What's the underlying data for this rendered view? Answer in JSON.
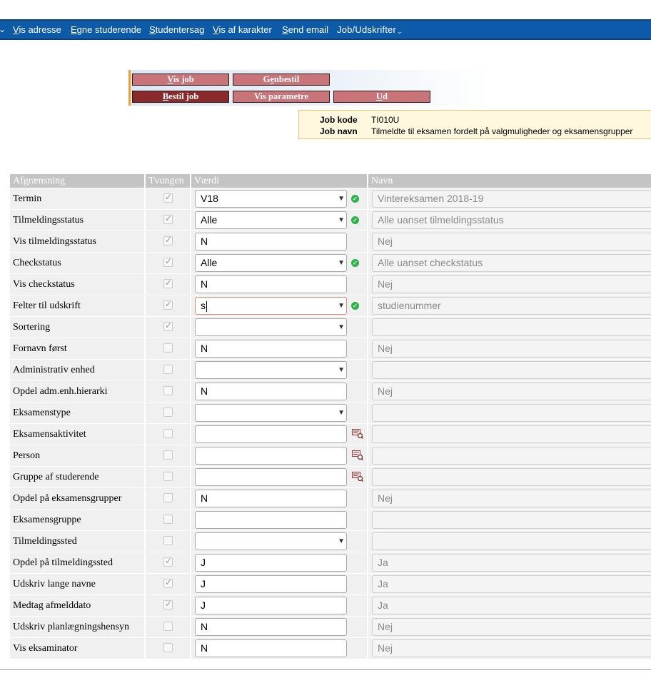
{
  "nav": {
    "items": [
      {
        "accel": "V",
        "rest": "is adresse"
      },
      {
        "accel": "E",
        "rest": "gne studerende"
      },
      {
        "accel": "S",
        "rest": "tudentersag"
      },
      {
        "accel": "V",
        "rest": "is af karakter"
      },
      {
        "accel": "S",
        "rest": "end email"
      }
    ],
    "job_menu": "Job/Udskrifter"
  },
  "buttons": {
    "vis_job": {
      "accel": "V",
      "rest": "is job"
    },
    "genbestil": {
      "pre": "G",
      "accel": "e",
      "rest": "nbestil"
    },
    "bestil_job": {
      "accel": "B",
      "rest": "estil job"
    },
    "vis_parametre": "Vis parametre",
    "ud": {
      "accel": "U",
      "rest": "d"
    }
  },
  "job_info": {
    "kode_label": "Job kode",
    "kode_value": "TI010U",
    "navn_label": "Job navn",
    "navn_value": "Tilmeldte til eksamen fordelt på valgmuligheder og eksamensgrupper"
  },
  "table": {
    "headers": {
      "afgraensning": "Afgrænsning",
      "tvungen": "Tvungen",
      "vaerdi": "Værdi",
      "navn": "Navn"
    },
    "rows": [
      {
        "label": "Termin",
        "forced": true,
        "value": "V18",
        "kind": "select",
        "status": "ok",
        "navn": "Vintereksamen 2018-19"
      },
      {
        "label": "Tilmeldingsstatus",
        "forced": true,
        "value": "Alle",
        "kind": "select",
        "status": "ok",
        "navn": "Alle uanset tilmeldingsstatus"
      },
      {
        "label": "Vis tilmeldingsstatus",
        "forced": true,
        "value": "N",
        "kind": "text",
        "status": "",
        "navn": "Nej"
      },
      {
        "label": "Checkstatus",
        "forced": true,
        "value": "Alle",
        "kind": "select",
        "status": "ok",
        "navn": "Alle uanset checkstatus"
      },
      {
        "label": "Vis checkstatus",
        "forced": true,
        "value": "N",
        "kind": "text",
        "status": "",
        "navn": "Nej"
      },
      {
        "label": "Felter til udskrift",
        "forced": true,
        "value": "s",
        "kind": "select-focused",
        "status": "ok",
        "navn": "studienummer"
      },
      {
        "label": "Sortering",
        "forced": true,
        "value": "",
        "kind": "select",
        "status": "",
        "navn": ""
      },
      {
        "label": "Fornavn først",
        "forced": false,
        "value": "N",
        "kind": "text",
        "status": "",
        "navn": "Nej"
      },
      {
        "label": "Administrativ enhed",
        "forced": false,
        "value": "",
        "kind": "select",
        "status": "",
        "navn": ""
      },
      {
        "label": "Opdel adm.enh.hierarki",
        "forced": false,
        "value": "N",
        "kind": "text",
        "status": "",
        "navn": "Nej"
      },
      {
        "label": "Eksamenstype",
        "forced": false,
        "value": "",
        "kind": "select",
        "status": "",
        "navn": ""
      },
      {
        "label": "Eksamensaktivitet",
        "forced": false,
        "value": "",
        "kind": "text",
        "status": "lookup",
        "navn": ""
      },
      {
        "label": "Person",
        "forced": false,
        "value": "",
        "kind": "text",
        "status": "lookup",
        "navn": ""
      },
      {
        "label": "Gruppe af studerende",
        "forced": false,
        "value": "",
        "kind": "text",
        "status": "lookup",
        "navn": ""
      },
      {
        "label": "Opdel på eksamensgrupper",
        "forced": false,
        "value": "N",
        "kind": "text",
        "status": "",
        "navn": "Nej"
      },
      {
        "label": "Eksamensgruppe",
        "forced": false,
        "value": "",
        "kind": "text",
        "status": "",
        "navn": ""
      },
      {
        "label": "Tilmeldingssted",
        "forced": false,
        "value": "",
        "kind": "select",
        "status": "",
        "navn": ""
      },
      {
        "label": "Opdel på tilmeldingssted",
        "forced": true,
        "value": "J",
        "kind": "text",
        "status": "",
        "navn": "Ja"
      },
      {
        "label": "Udskriv lange navne",
        "forced": true,
        "value": "J",
        "kind": "text",
        "status": "",
        "navn": "Ja"
      },
      {
        "label": "Medtag afmelddato",
        "forced": true,
        "value": "J",
        "kind": "text",
        "status": "",
        "navn": "Ja"
      },
      {
        "label": "Udskriv planlægningshensyn",
        "forced": false,
        "value": "N",
        "kind": "text",
        "status": "",
        "navn": "Nej"
      },
      {
        "label": "Vis eksaminator",
        "forced": false,
        "value": "N",
        "kind": "text",
        "status": "",
        "navn": "Nej"
      }
    ]
  },
  "colors": {
    "nav_bg": "#0d5ba8",
    "button_light": "#c87478",
    "button_dark": "#8a2a2a",
    "status_ok": "#2db34a"
  }
}
